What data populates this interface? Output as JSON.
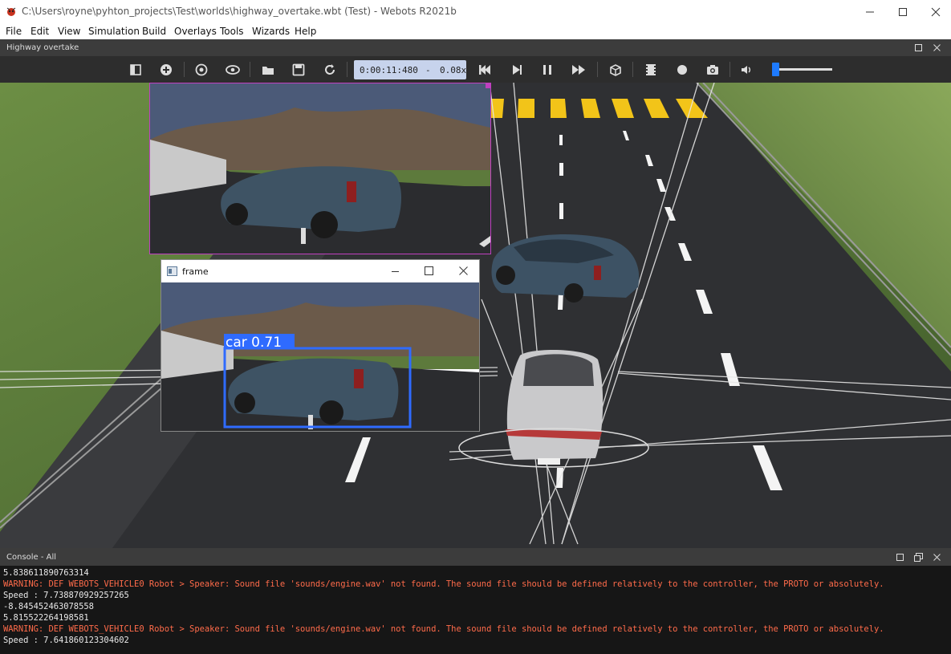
{
  "window": {
    "title": "C:\\Users\\royne\\pyhton_projects\\Test\\worlds\\highway_overtake.wbt (Test) - Webots R2021b"
  },
  "menu": [
    "File",
    "Edit",
    "View",
    "Simulation",
    "Build",
    "Overlays",
    "Tools",
    "Wizards",
    "Help"
  ],
  "panel": {
    "title": "Highway overtake"
  },
  "toolbar": {
    "time": "0:00:11:480",
    "separator": "-",
    "speed": "0.08x",
    "volume_level": 0.05
  },
  "frame_window": {
    "title": "frame",
    "detection_label": "car 0.71"
  },
  "console": {
    "title": "Console - All",
    "lines": [
      {
        "text": "5.838611890763314",
        "type": "normal"
      },
      {
        "text": "WARNING: DEF WEBOTS_VEHICLE0 Robot > Speaker: Sound file 'sounds/engine.wav' not found. The sound file should be defined relatively to the controller, the PROTO or absolutely.",
        "type": "warn"
      },
      {
        "text": "Speed : 7.738870929257265",
        "type": "normal"
      },
      {
        "text": "-8.845452463078558",
        "type": "normal"
      },
      {
        "text": "5.815522264198581",
        "type": "normal"
      },
      {
        "text": "WARNING: DEF WEBOTS_VEHICLE0 Robot > Speaker: Sound file 'sounds/engine.wav' not found. The sound file should be defined relatively to the controller, the PROTO or absolutely.",
        "type": "warn"
      },
      {
        "text": "Speed : 7.641860123304602",
        "type": "normal"
      }
    ]
  },
  "colors": {
    "accent": "#1e90ff",
    "warning": "#ff6b4a",
    "camera_border": "#c040c0",
    "detection_box": "#2f6bff"
  }
}
